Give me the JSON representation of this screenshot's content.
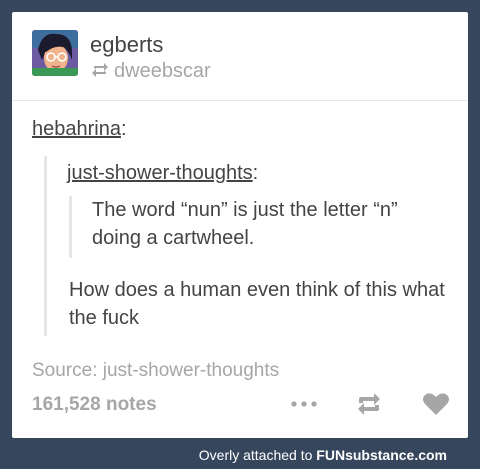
{
  "post": {
    "blog_name": "egberts",
    "reblogged_from": "dweebscar",
    "chain": {
      "user1": "hebahrina",
      "user2": "just-shower-thoughts",
      "original_text": "The word “nun” is just the letter “n” doing a cartwheel.",
      "reply_text": "How does a human even think of this what the fuck"
    },
    "source_label": "Source: ",
    "source_name": "just-shower-thoughts",
    "notes": "161,528 notes"
  },
  "footer": {
    "overlay_prefix": "Overly attached to ",
    "brand": "FUNsubstance.com"
  },
  "icons": {
    "reblog": "reblog-icon",
    "more": "more-icon",
    "heart": "heart-icon"
  },
  "colors": {
    "background": "#36465d",
    "card": "#ffffff",
    "muted": "#a6a6a6",
    "text": "#444444"
  }
}
